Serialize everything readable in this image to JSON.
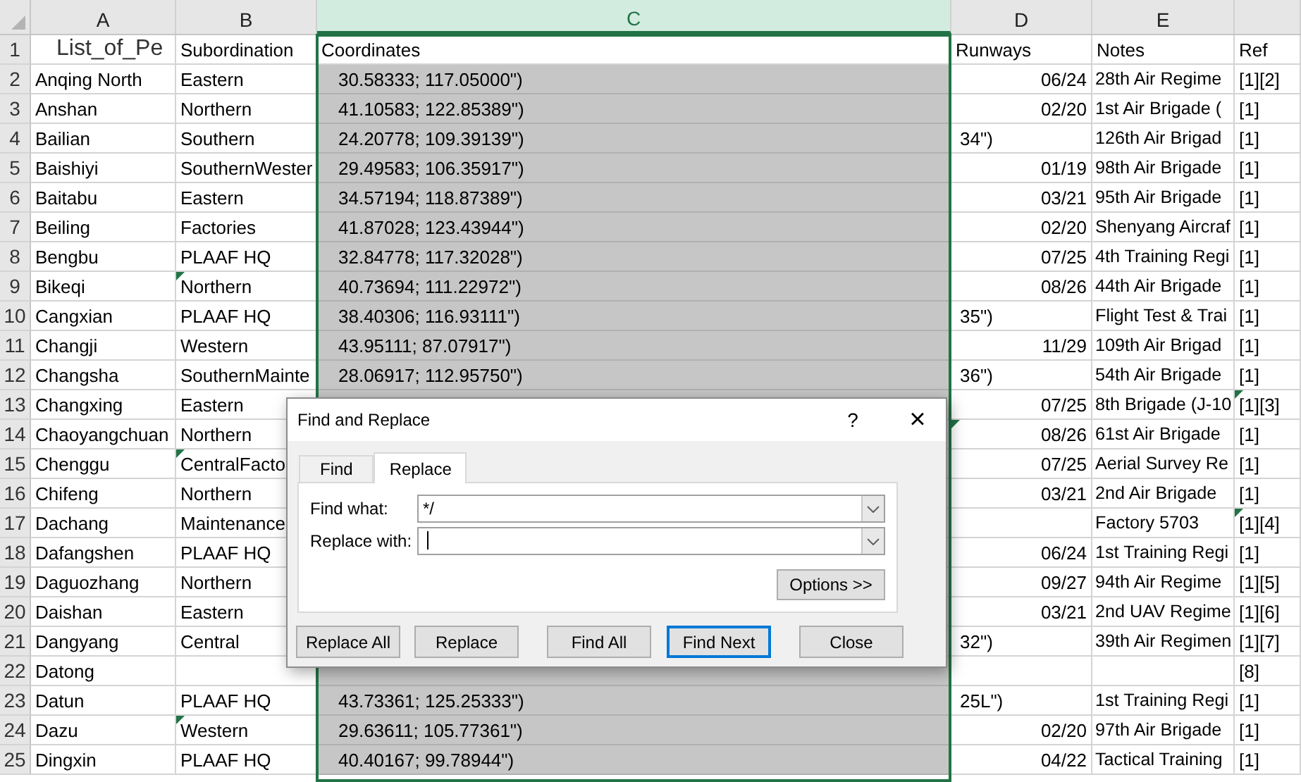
{
  "sheet": {
    "columns": [
      {
        "letter": "A",
        "selected": false
      },
      {
        "letter": "B",
        "selected": false
      },
      {
        "letter": "C",
        "selected": true
      },
      {
        "letter": "D",
        "selected": false
      },
      {
        "letter": "E",
        "selected": false
      }
    ],
    "header_row": {
      "row": "1",
      "title": "List_of_Pe",
      "headings": [
        "Subordination",
        "Coordinates",
        "Runways",
        "Notes",
        "Ref"
      ]
    },
    "rows": [
      {
        "row": "2",
        "name": "Anqing North",
        "subordination": "Eastern",
        "coordinates": "30.58333; 117.05000\")",
        "runways": "06/24",
        "right_aligned": true,
        "notes": "28th Air Regime",
        "ref": "[1][2]"
      },
      {
        "row": "3",
        "name": "Anshan",
        "subordination": "Northern",
        "coordinates": "41.10583; 122.85389\")",
        "runways": "02/20",
        "right_aligned": true,
        "notes": "1st Air Brigade (",
        "ref": "[1]"
      },
      {
        "row": "4",
        "name": "Bailian",
        "subordination": "Southern",
        "coordinates": "24.20778; 109.39139\")",
        "runways": "34\")",
        "right_aligned": false,
        "notes": "126th Air Brigad",
        "ref": "[1]"
      },
      {
        "row": "5",
        "name": "Baishiyi",
        "subordination": "SouthernWester",
        "coordinates": "29.49583; 106.35917\")",
        "runways": "01/19",
        "right_aligned": true,
        "notes": "98th Air Brigade",
        "ref": "[1]"
      },
      {
        "row": "6",
        "name": "Baitabu",
        "subordination": "Eastern",
        "coordinates": "34.57194; 118.87389\")",
        "runways": "03/21",
        "right_aligned": true,
        "notes": "95th Air Brigade",
        "ref": "[1]"
      },
      {
        "row": "7",
        "name": "Beiling",
        "subordination": "Factories",
        "coordinates": "41.87028; 123.43944\")",
        "runways": "02/20",
        "right_aligned": true,
        "notes": "Shenyang Aircraf",
        "ref": "[1]"
      },
      {
        "row": "8",
        "name": "Bengbu",
        "subordination": "PLAAF HQ",
        "coordinates": "32.84778; 117.32028\")",
        "runways": "07/25",
        "right_aligned": true,
        "notes": "4th Training Regi",
        "ref": "[1]"
      },
      {
        "row": "9",
        "name": "Bikeqi",
        "subordination": "Northern",
        "coordinates": "40.73694; 111.22972\")",
        "runways": "08/26",
        "right_aligned": true,
        "notes": "44th Air Brigade",
        "ref": "[1]",
        "flagged": {
          "subordination": true
        }
      },
      {
        "row": "10",
        "name": "Cangxian",
        "subordination": "PLAAF HQ",
        "coordinates": "38.40306; 116.93111\")",
        "runways": "35\")",
        "right_aligned": false,
        "notes": "Flight Test & Trai",
        "ref": "[1]"
      },
      {
        "row": "11",
        "name": "Changji",
        "subordination": "Western",
        "coordinates": "43.95111; 87.07917\")",
        "runways": "11/29",
        "right_aligned": true,
        "notes": "109th Air Brigad",
        "ref": "[1]"
      },
      {
        "row": "12",
        "name": "Changsha",
        "subordination": "SouthernMainte",
        "coordinates": "28.06917; 112.95750\")",
        "runways": "36\")",
        "right_aligned": false,
        "notes": "54th Air Brigade",
        "ref": "[1]"
      },
      {
        "row": "13",
        "name": "Changxing",
        "subordination": "Eastern",
        "runways": "07/25",
        "right_aligned": true,
        "notes": "8th Brigade (J-10",
        "ref": "[1][3]",
        "flagged": {
          "ref": true
        }
      },
      {
        "row": "14",
        "name": "Chaoyangchuan",
        "subordination": "Northern",
        "runways": "08/26",
        "right_aligned": true,
        "notes": "61st Air Brigade",
        "ref": "[1]",
        "flagged": {
          "runways": true
        }
      },
      {
        "row": "15",
        "name": "Chenggu",
        "subordination": "CentralFacto",
        "runways": "07/25",
        "right_aligned": true,
        "notes": "Aerial Survey Re",
        "ref": "[1]",
        "flagged": {
          "subordination": true
        }
      },
      {
        "row": "16",
        "name": "Chifeng",
        "subordination": "Northern",
        "runways": "03/21",
        "right_aligned": true,
        "notes": "2nd Air Brigade",
        "ref": "[1]"
      },
      {
        "row": "17",
        "name": "Dachang",
        "subordination": "Maintenance",
        "notes": "Factory 5703",
        "ref": "[1][4]",
        "flagged": {
          "ref": true
        }
      },
      {
        "row": "18",
        "name": "Dafangshen",
        "subordination": "PLAAF HQ",
        "runways": "06/24",
        "right_aligned": true,
        "notes": "1st Training Regi",
        "ref": "[1]"
      },
      {
        "row": "19",
        "name": "Daguozhang",
        "subordination": "Northern",
        "runways": "09/27",
        "right_aligned": true,
        "notes": "94th Air Regime",
        "ref": "[1][5]"
      },
      {
        "row": "20",
        "name": "Daishan",
        "subordination": "Eastern",
        "runways": "03/21",
        "right_aligned": true,
        "notes": "2nd UAV Regime",
        "ref": "[1][6]"
      },
      {
        "row": "21",
        "name": "Dangyang",
        "subordination": "Central",
        "runways": "32\")",
        "right_aligned": false,
        "notes": "39th Air Regimen",
        "ref": "[1][7]"
      },
      {
        "row": "22",
        "name": "Datong",
        "ref": "[8]"
      },
      {
        "row": "23",
        "name": "Datun",
        "subordination": "PLAAF HQ",
        "coordinates": "43.73361; 125.25333\")",
        "runways": "25L\")",
        "right_aligned": false,
        "notes": "1st Training Regi",
        "ref": "[1]"
      },
      {
        "row": "24",
        "name": "Dazu",
        "subordination": "Western",
        "coordinates": "29.63611; 105.77361\")",
        "runways": "02/20",
        "right_aligned": true,
        "notes": "97th Air Brigade",
        "ref": "[1]",
        "flagged": {
          "subordination": true
        }
      },
      {
        "row": "25",
        "name": "Dingxin",
        "subordination": "PLAAF HQ",
        "coordinates": "40.40167; 99.78944\")",
        "runways": "04/22",
        "right_aligned": true,
        "notes": "Tactical Training",
        "ref": "[1]"
      }
    ]
  },
  "dialog": {
    "title": "Find and Replace",
    "help": "?",
    "close": "×",
    "tabs": [
      {
        "label": "Find",
        "selected": false
      },
      {
        "label": "Replace",
        "selected": true
      }
    ],
    "fields": [
      {
        "label": "Find what:",
        "value": "*/",
        "focused": false
      },
      {
        "label": "Replace with:",
        "focused": true
      }
    ],
    "options_button": "Options >>",
    "buttons": [
      {
        "label": "Replace All",
        "default": false
      },
      {
        "label": "Replace",
        "default": false
      },
      {
        "label": "Find All",
        "default": false
      },
      {
        "label": "Find Next",
        "default": true
      },
      {
        "label": "Close",
        "default": false
      }
    ]
  }
}
